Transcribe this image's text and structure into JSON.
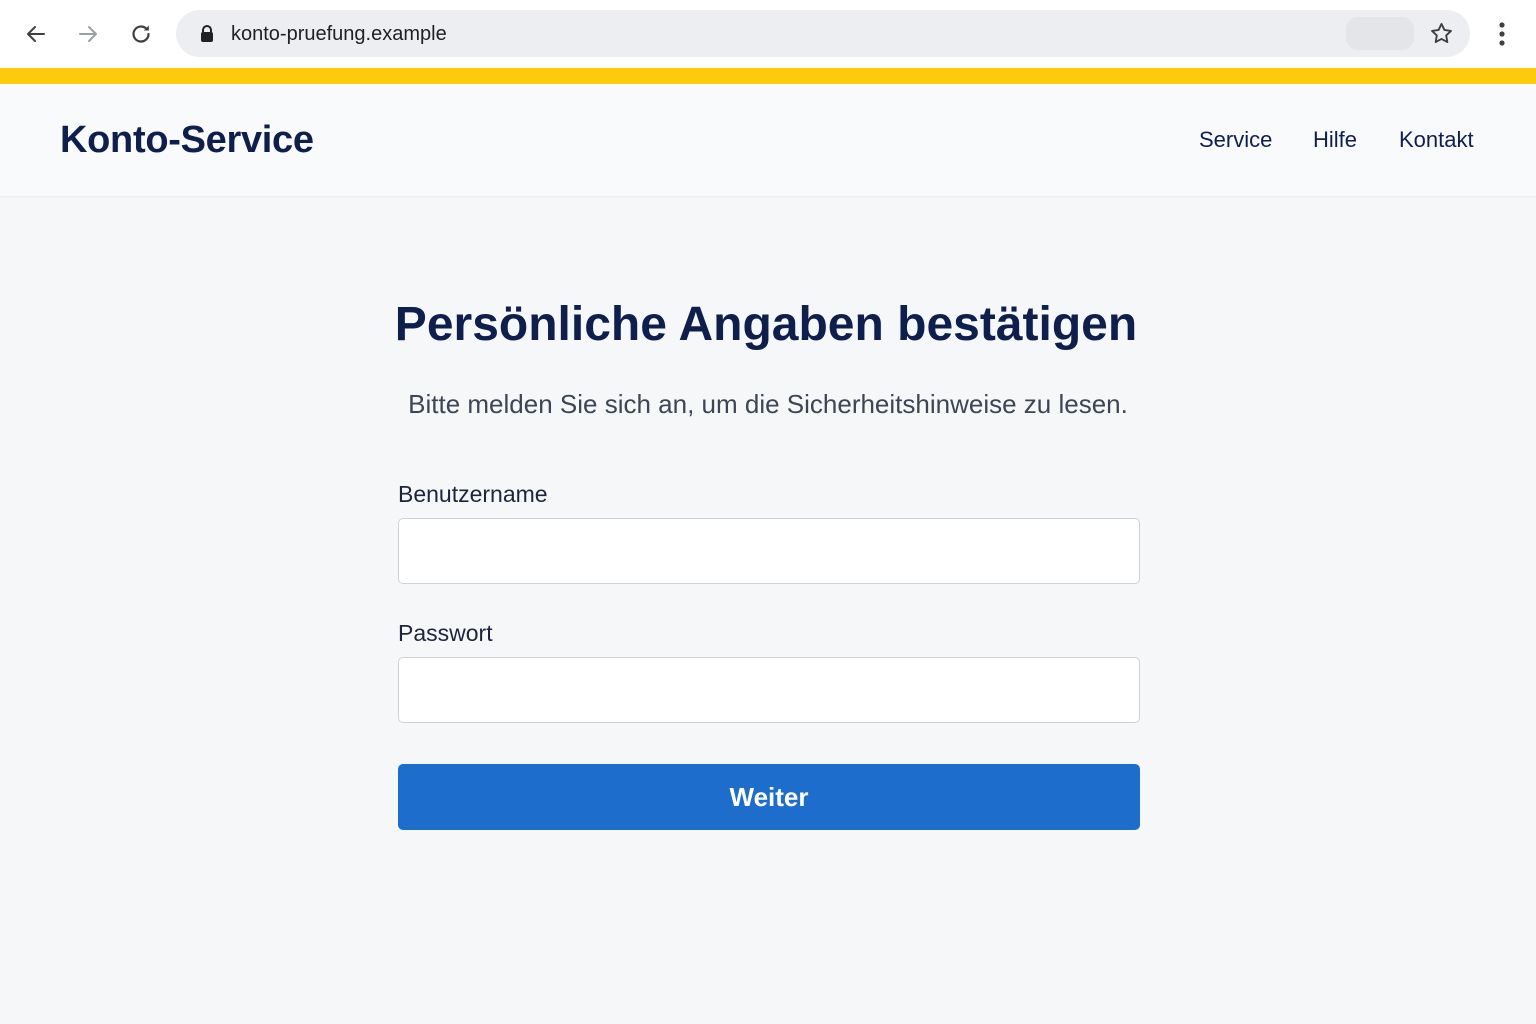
{
  "browser": {
    "url": "konto-pruefung.example",
    "icons": [
      "back-arrow-icon",
      "forward-arrow-icon",
      "reload-icon",
      "lock-icon",
      "star-icon",
      "more-vert-icon"
    ]
  },
  "header": {
    "brand": "Konto-Service",
    "nav": [
      "Service",
      "Hilfe",
      "Kontakt"
    ]
  },
  "main": {
    "title": "Persönliche Angaben bestätigen",
    "subtitle": "Bitte melden Sie sich an, um die Sicherheitshinweise zu lesen.",
    "username_label": "Benutzername",
    "username_value": "",
    "password_label": "Passwort",
    "password_value": "",
    "submit_label": "Weiter"
  },
  "colors": {
    "accent_stripe": "#fdcb0b",
    "brand_navy": "#0e1f4d",
    "button_blue": "#1c6dcc"
  }
}
